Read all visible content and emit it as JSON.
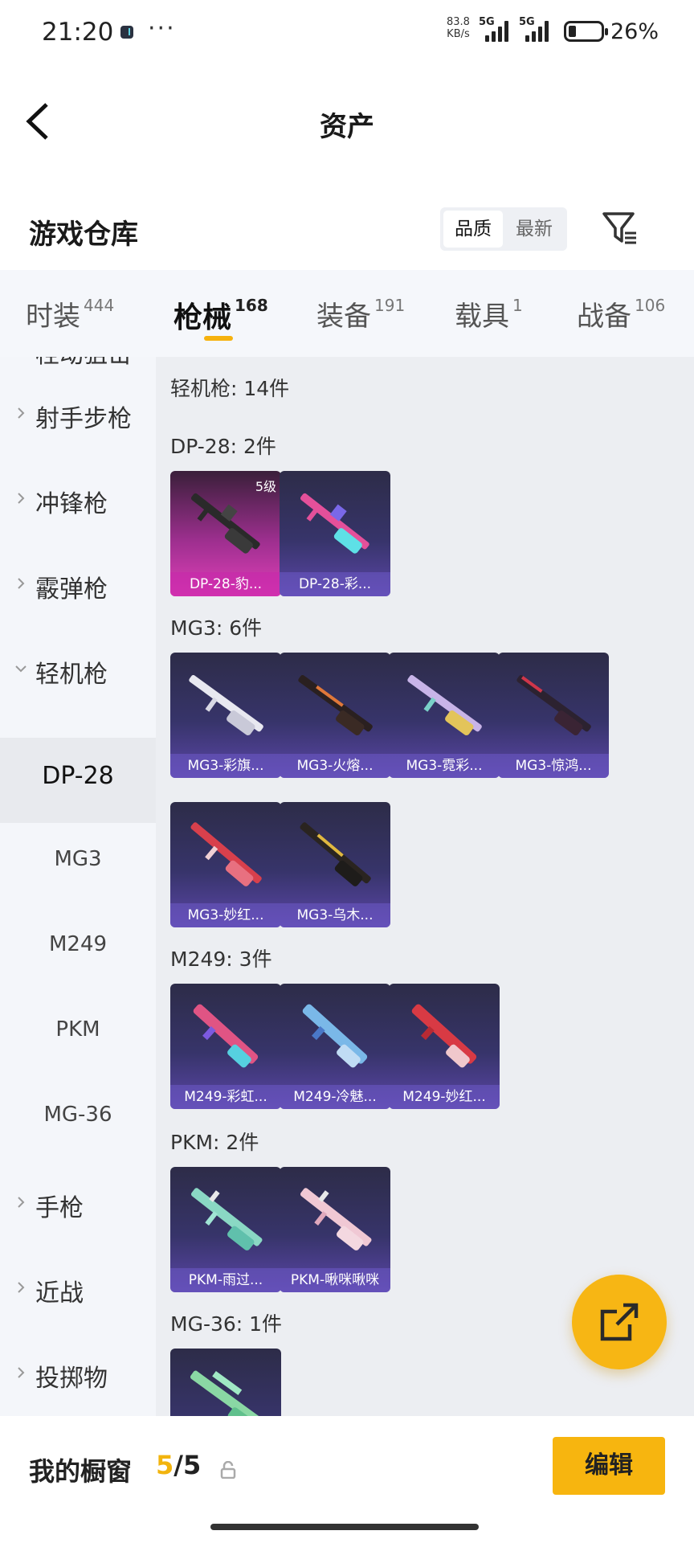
{
  "status_bar": {
    "time": "21:20",
    "dots": "···",
    "net_speed": "83.8",
    "net_unit": "KB/s",
    "sim1": "5G",
    "sim2": "5G",
    "battery": "26%"
  },
  "header": {
    "title": "资产"
  },
  "warehouse": {
    "title": "游戏仓库",
    "sort_quality": "品质",
    "sort_newest": "最新"
  },
  "tabs": [
    {
      "label": "时装",
      "count": "444"
    },
    {
      "label": "枪械",
      "count": "168"
    },
    {
      "label": "装备",
      "count": "191"
    },
    {
      "label": "载具",
      "count": "1"
    },
    {
      "label": "战备",
      "count": "106"
    }
  ],
  "sidebar": {
    "partial": "栓动狙击",
    "items": [
      "射手步枪",
      "冲锋枪",
      "霰弹枪",
      "轻机枪"
    ],
    "subitems": [
      "DP-28",
      "MG3",
      "M249",
      "PKM",
      "MG-36"
    ],
    "after": [
      "手枪",
      "近战",
      "投掷物"
    ]
  },
  "main": {
    "category_total": "轻机枪: 14件",
    "sections": [
      {
        "title": "DP-28: 2件",
        "items": [
          {
            "name": "DP-28-豹...",
            "badge": "5级"
          },
          {
            "name": "DP-28-彩..."
          }
        ]
      },
      {
        "title": "MG3: 6件",
        "items": [
          {
            "name": "MG3-彩旗..."
          },
          {
            "name": "MG3-火熔..."
          },
          {
            "name": "MG3-霓彩..."
          },
          {
            "name": "MG3-惊鸿..."
          },
          {
            "name": "MG3-妙红..."
          },
          {
            "name": "MG3-乌木..."
          }
        ]
      },
      {
        "title": "M249: 3件",
        "items": [
          {
            "name": "M249-彩虹..."
          },
          {
            "name": "M249-冷魅..."
          },
          {
            "name": "M249-妙红..."
          }
        ]
      },
      {
        "title": "PKM: 2件",
        "items": [
          {
            "name": "PKM-雨过..."
          },
          {
            "name": "PKM-啾咪啾咪"
          }
        ]
      },
      {
        "title": "MG-36: 1件",
        "items": []
      }
    ]
  },
  "bottom": {
    "title": "我的橱窗",
    "current": "5",
    "separator": "/",
    "total": "5",
    "edit": "编辑"
  },
  "colors": {
    "accent": "#f7b50f",
    "legendary": "#e03fb8",
    "epic": "#5b46a8"
  }
}
